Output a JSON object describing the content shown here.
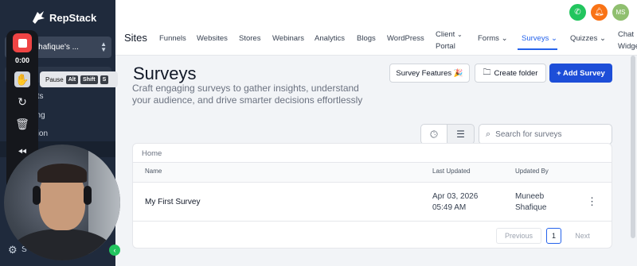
{
  "brand": {
    "name": "RepStack"
  },
  "sidebar": {
    "account": "eeb Shafique's ...",
    "items": [
      "gents",
      "keting",
      "mation"
    ],
    "bottom_label": "S"
  },
  "recorder": {
    "time": "0:00",
    "tooltip": {
      "label": "Pause",
      "keys": [
        "Alt",
        "Shift",
        "S"
      ]
    }
  },
  "topbar": {
    "avatar": "MS",
    "colors": {
      "phone": "#22c55e",
      "bell": "#f97316",
      "avatar": "#8fbf6f"
    }
  },
  "nav": {
    "title": "Sites",
    "tabs": [
      {
        "label": "Funnels"
      },
      {
        "label": "Websites"
      },
      {
        "label": "Stores"
      },
      {
        "label": "Webinars"
      },
      {
        "label": "Analytics"
      },
      {
        "label": "Blogs"
      },
      {
        "label": "WordPress"
      },
      {
        "label": "Client",
        "label2": "Portal"
      },
      {
        "label": "Forms"
      },
      {
        "label": "Surveys"
      },
      {
        "label": "Quizzes"
      },
      {
        "label": "Chat",
        "label2": "Widge"
      }
    ],
    "active_tab": "Surveys"
  },
  "page": {
    "title": "Surveys",
    "subtitle": "Craft engaging surveys to gather insights, understand your audience, and drive smarter decisions effortlessly",
    "buttons": {
      "features": "Survey Features 🎉",
      "create_folder": "Create folder",
      "add_survey": "+ Add Survey"
    }
  },
  "search": {
    "placeholder": "Search for surveys"
  },
  "breadcrumb": "Home",
  "table": {
    "columns": [
      "Name",
      "Last Updated",
      "Updated By"
    ],
    "rows": [
      {
        "name": "My First Survey",
        "date": "Apr 03, 2026",
        "time": "05:49 AM",
        "by_first": "Muneeb",
        "by_last": "Shafique"
      }
    ]
  },
  "pagination": {
    "previous": "Previous",
    "current": "1",
    "next": "Next"
  },
  "colors": {
    "primary": "#1d4ed8",
    "sidebar": "#1f2a3c",
    "record": "#ef4444"
  }
}
